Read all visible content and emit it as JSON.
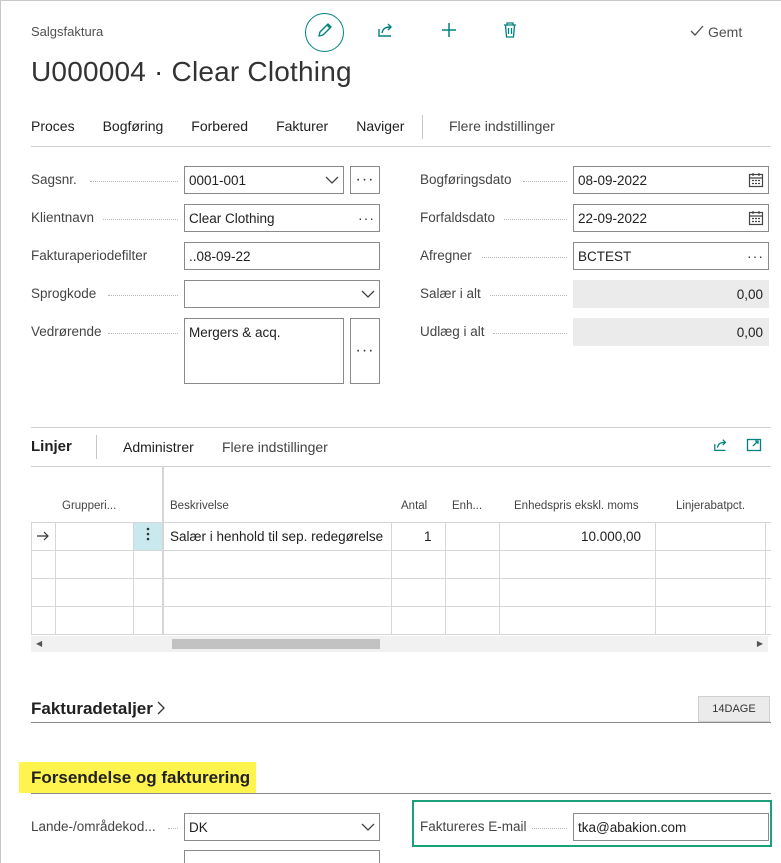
{
  "header": {
    "page_type": "Salgsfaktura",
    "title": "U000004 · Clear Clothing",
    "saved_label": "Gemt"
  },
  "actions": [
    "Proces",
    "Bogføring",
    "Forbered",
    "Fakturer",
    "Naviger"
  ],
  "actions_more": "Flere indstillinger",
  "general": {
    "left": [
      {
        "label": "Sagsnr.",
        "value": "0001-001"
      },
      {
        "label": "Klientnavn",
        "value": "Clear Clothing"
      },
      {
        "label": "Fakturaperiodefilter",
        "value": "..08-09-22"
      },
      {
        "label": "Sprogkode",
        "value": ""
      },
      {
        "label": "Vedrørende",
        "value": "Mergers & acq."
      }
    ],
    "right": [
      {
        "label": "Bogføringsdato",
        "value": "08-09-2022"
      },
      {
        "label": "Forfaldsdato",
        "value": "22-09-2022"
      },
      {
        "label": "Afregner",
        "value": "BCTEST"
      },
      {
        "label": "Salær i alt",
        "value": "0,00"
      },
      {
        "label": "Udlæg i alt",
        "value": "0,00"
      }
    ]
  },
  "lines": {
    "title": "Linjer",
    "actions": [
      "Administrer",
      "Flere indstillinger"
    ],
    "columns": [
      "Grupperi...",
      "Beskrivelse",
      "Antal",
      "Enh...",
      "Enhedspris ekskl. moms",
      "Linjerabatpct."
    ],
    "rows": [
      {
        "beskrivelse": "Salær i henhold til sep. redegørelse",
        "antal": "1",
        "enhedspris": "10.000,00"
      }
    ]
  },
  "fakturadetaljer": {
    "title": "Fakturadetaljer",
    "badge": "14DAGE"
  },
  "forsendelse": {
    "title": "Forsendelse og fakturering",
    "left_label": "Lande-/områdekod...",
    "left_value": "DK",
    "right_label": "Faktureres E-mail",
    "right_value": "tka@abakion.com"
  },
  "colors": {
    "accent": "#00827f",
    "highlight": "#fff34d",
    "green_outline": "#1aa07a",
    "selected_cell": "#c9e9ef"
  }
}
